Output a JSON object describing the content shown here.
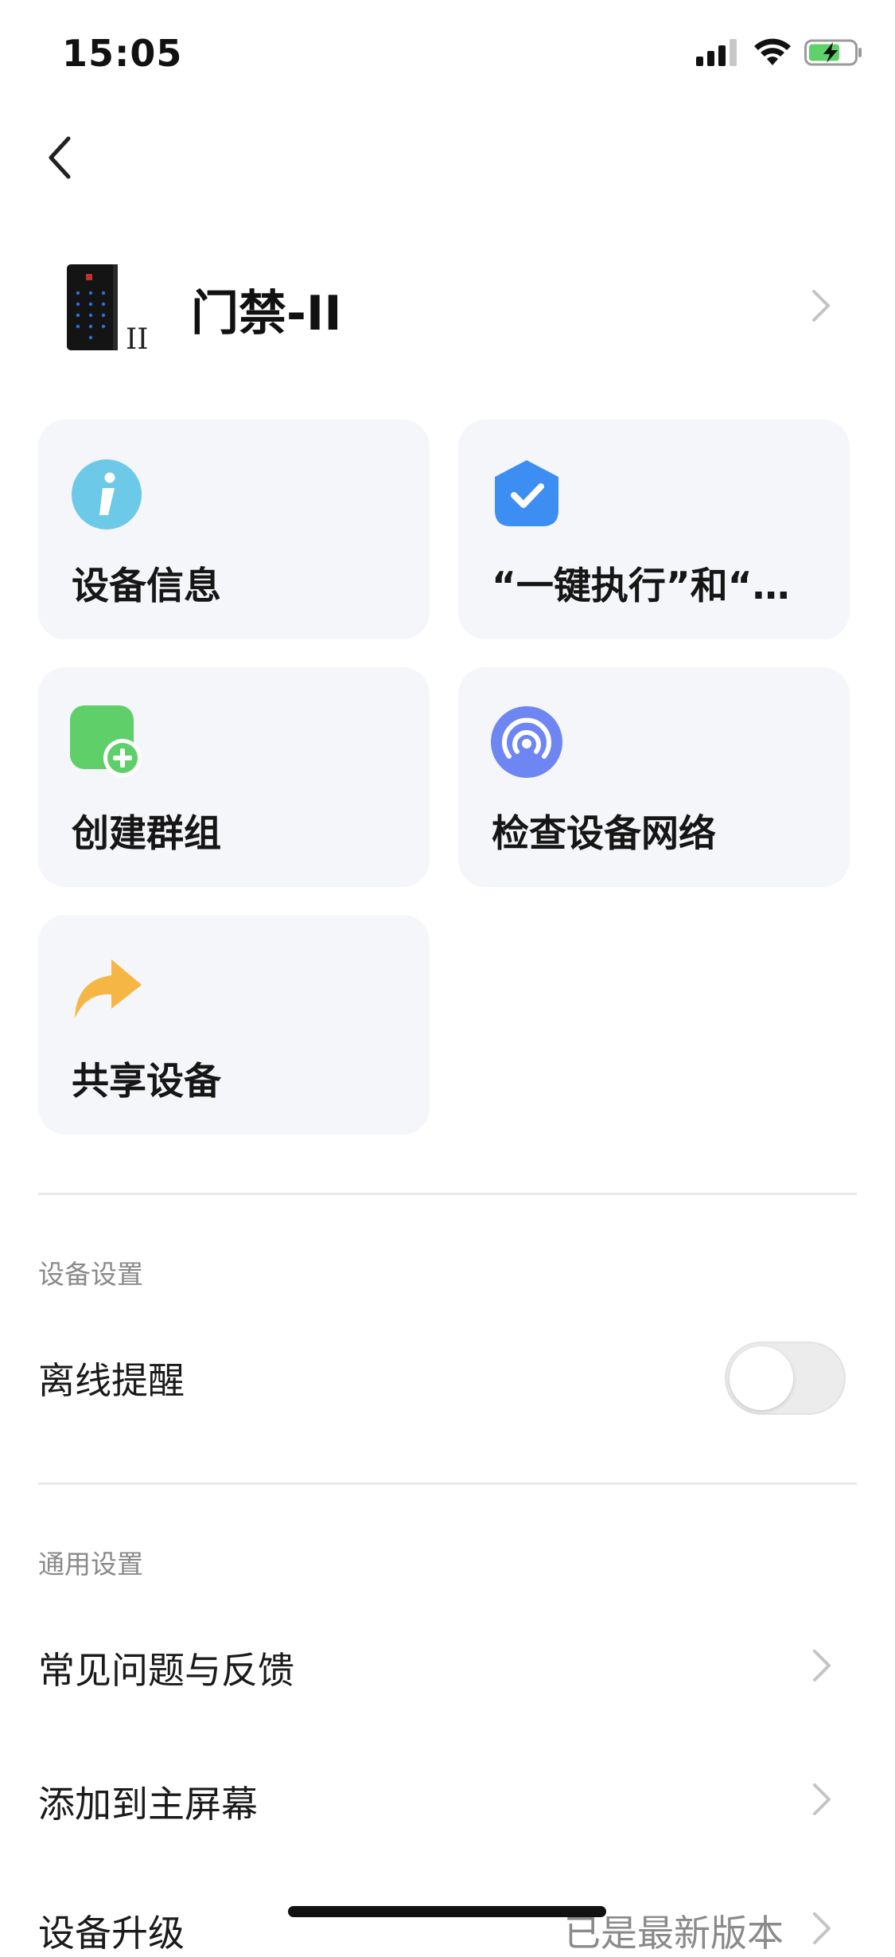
{
  "status_bar": {
    "time": "15:05",
    "icons": [
      "cellular-signal-icon",
      "wifi-icon",
      "battery-charging-icon"
    ]
  },
  "nav": {
    "back_icon": "chevron-left-icon"
  },
  "device": {
    "name": "门禁-II",
    "thumb_label": "II"
  },
  "actions": [
    {
      "label": "设备信息",
      "icon": "info-icon"
    },
    {
      "label": "“一键执行”和“…",
      "icon": "check-shield-icon"
    },
    {
      "label": "创建群组",
      "icon": "add-group-icon"
    },
    {
      "label": "检查设备网络",
      "icon": "network-signal-icon"
    },
    {
      "label": "共享设备",
      "icon": "share-arrow-icon"
    }
  ],
  "device_settings": {
    "title": "设备设置",
    "offline_reminder": {
      "label": "离线提醒",
      "enabled": false
    }
  },
  "general_settings": {
    "title": "通用设置",
    "items": [
      {
        "label": "常见问题与反馈"
      },
      {
        "label": "添加到主屏幕"
      },
      {
        "label": "设备升级",
        "value": "已是最新版本"
      }
    ]
  },
  "colors": {
    "card_bg": "#f5f6f9",
    "info_icon": "#6cc9e8",
    "check_icon": "#3d8ef2",
    "group_icon": "#5fcf6a",
    "network_icon": "#6e86f2",
    "share_icon": "#f5b645"
  }
}
